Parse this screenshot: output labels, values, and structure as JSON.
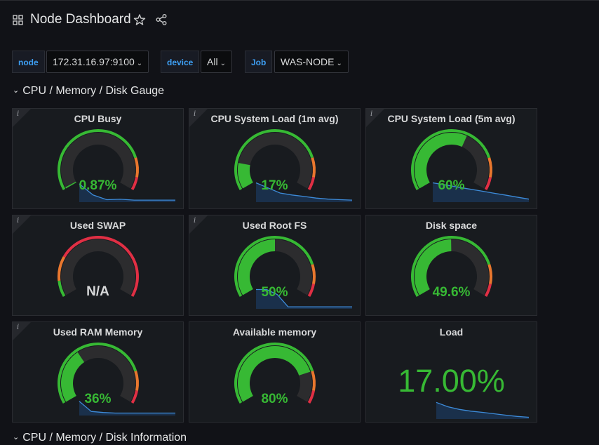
{
  "header": {
    "title": "Node Dashboard",
    "apps_icon": "grid-icon",
    "star_icon": "star-icon",
    "share_icon": "share-icon"
  },
  "variables": [
    {
      "label": "node",
      "value": "172.31.16.97:9100"
    },
    {
      "label": "device",
      "value": "All"
    },
    {
      "label": "Job",
      "value": "WAS-NODE"
    }
  ],
  "rows": [
    {
      "title": "CPU / Memory / Disk Gauge"
    },
    {
      "title": "CPU / Memory / Disk Information"
    }
  ],
  "colors": {
    "green": "#37b934",
    "orange": "#e8772e",
    "red": "#e02f44",
    "gauge_bg": "#2c2c2e",
    "spark_line": "#3d8bd9",
    "spark_fill": "#1b3350",
    "link_blue": "#3d9ef2"
  },
  "panels": [
    {
      "title": "CPU Busy",
      "value": "0.87%",
      "percent": 0.87,
      "info": true,
      "sparkline": [
        0.9,
        0.35,
        0.12,
        0.14,
        0.1,
        0.1,
        0.1,
        0.1
      ]
    },
    {
      "title": "CPU System Load (1m avg)",
      "value": "17%",
      "percent": 17,
      "info": true,
      "sparkline": [
        0.95,
        0.7,
        0.45,
        0.35,
        0.28,
        0.2,
        0.15,
        0.12,
        0.1
      ]
    },
    {
      "title": "CPU System Load (5m avg)",
      "value": "60%",
      "percent": 60,
      "info": true,
      "sparkline": [
        0.95,
        0.85,
        0.75,
        0.65,
        0.55,
        0.45,
        0.35,
        0.25,
        0.15
      ]
    },
    {
      "title": "Used SWAP",
      "value": "N/A",
      "percent": null,
      "info": true,
      "sparkline": []
    },
    {
      "title": "Used Root FS",
      "value": "50%",
      "percent": 50,
      "info": true,
      "sparkline": [
        0.95,
        0.95,
        0.7,
        0.1,
        0.1,
        0.1,
        0.1,
        0.1,
        0.1,
        0.1
      ]
    },
    {
      "title": "Disk space",
      "value": "49.6%",
      "percent": 49.6,
      "info": false,
      "sparkline": []
    },
    {
      "title": "Used RAM Memory",
      "value": "36%",
      "percent": 36,
      "info": true,
      "sparkline": [
        0.7,
        0.2,
        0.15,
        0.12,
        0.12,
        0.12,
        0.12,
        0.12,
        0.12
      ]
    },
    {
      "title": "Available memory",
      "value": "80%",
      "percent": 80,
      "info": false,
      "sparkline": []
    },
    {
      "title": "Load",
      "value": "17.00%",
      "percent": null,
      "info": false,
      "stat": true,
      "sparkline": [
        0.95,
        0.7,
        0.55,
        0.45,
        0.38,
        0.3,
        0.22,
        0.15,
        0.1
      ]
    }
  ]
}
